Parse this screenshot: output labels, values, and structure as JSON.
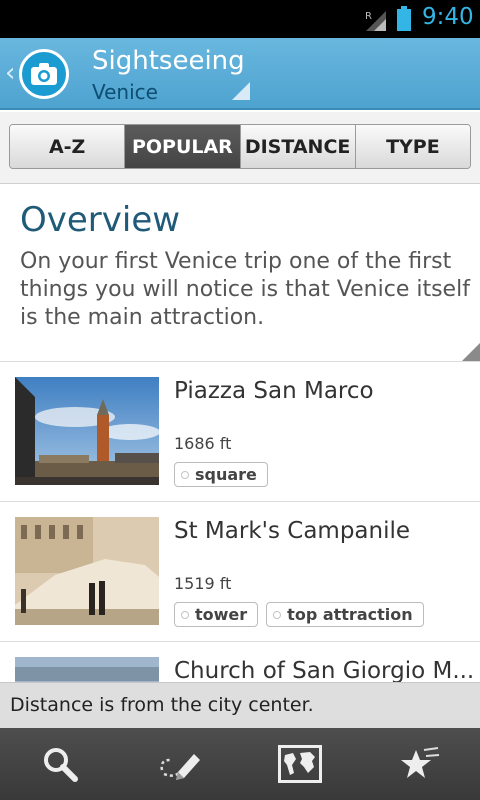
{
  "status_bar": {
    "time": "9:40",
    "signal_indicator": "R",
    "colors": {
      "time": "#33b5e5"
    }
  },
  "action_bar": {
    "back_icon": "chevron-left-icon",
    "app_icon": "camera-icon",
    "title": "Sightseeing",
    "subtitle": "Venice",
    "colors": {
      "background": "#5aacd8",
      "subtitle": "#0e4e72"
    }
  },
  "tabs": [
    {
      "label": "A-Z",
      "active": false
    },
    {
      "label": "POPULAR",
      "active": true
    },
    {
      "label": "DISTANCE",
      "active": false
    },
    {
      "label": "TYPE",
      "active": false
    }
  ],
  "overview": {
    "heading": "Overview",
    "text": "On your first Venice trip one of the first things you will notice is that Venice itself is the main attraction."
  },
  "list": [
    {
      "title": "Piazza San Marco",
      "distance": "1686 ft",
      "tags": [
        "square"
      ]
    },
    {
      "title": "St Mark's Campanile",
      "distance": "1519 ft",
      "tags": [
        "tower",
        "top attraction"
      ]
    },
    {
      "title": "Church of San Giorgio M...",
      "distance": "",
      "tags": []
    }
  ],
  "info_bar": {
    "text": "Distance is from the city center."
  },
  "bottom_bar": {
    "buttons": [
      {
        "icon": "search-icon"
      },
      {
        "icon": "edit-icon"
      },
      {
        "icon": "world-map-icon"
      },
      {
        "icon": "favorite-star-icon"
      }
    ]
  }
}
